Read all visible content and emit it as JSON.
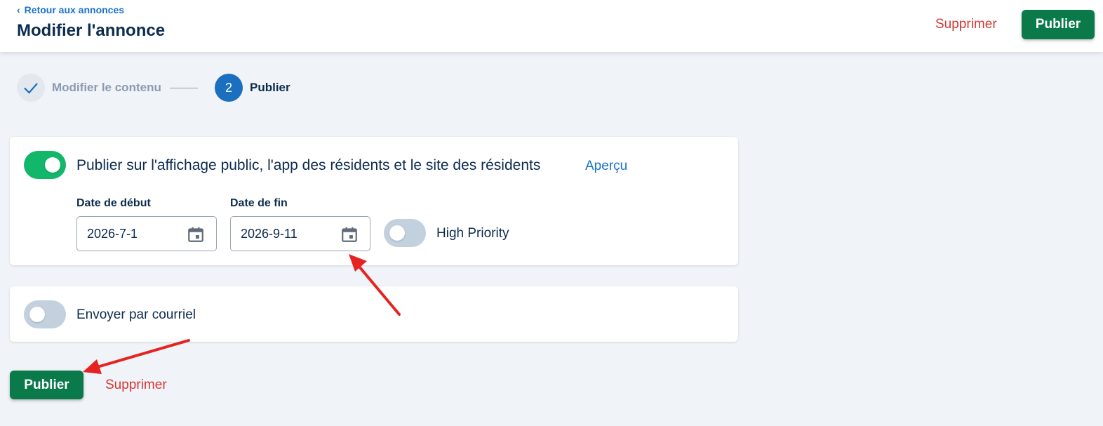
{
  "header": {
    "back_label": "Retour aux annonces",
    "title": "Modifier l'annonce",
    "delete_label": "Supprimer",
    "publish_label": "Publier"
  },
  "stepper": {
    "step1_label": "Modifier le contenu",
    "step1_state": "completed",
    "step2_number": "2",
    "step2_label": "Publier",
    "step2_state": "active"
  },
  "publish_card": {
    "toggle_on": true,
    "label": "Publier sur l'affichage public, l'app des résidents et le site des résidents",
    "preview_label": "Aperçu",
    "start_date_label": "Date de début",
    "start_date_value": "2026-7-1",
    "end_date_label": "Date de fin",
    "end_date_value": "2026-9-11",
    "priority_toggle_on": false,
    "priority_label": "High Priority"
  },
  "email_card": {
    "toggle_on": false,
    "label": "Envoyer par courriel"
  },
  "footer": {
    "publish_label": "Publier",
    "delete_label": "Supprimer"
  },
  "colors": {
    "primary_green": "#0a7a4a",
    "toggle_on": "#12b76a",
    "link_blue": "#1a73c8",
    "danger_red": "#d93636",
    "annotation_arrow": "#e52421"
  }
}
